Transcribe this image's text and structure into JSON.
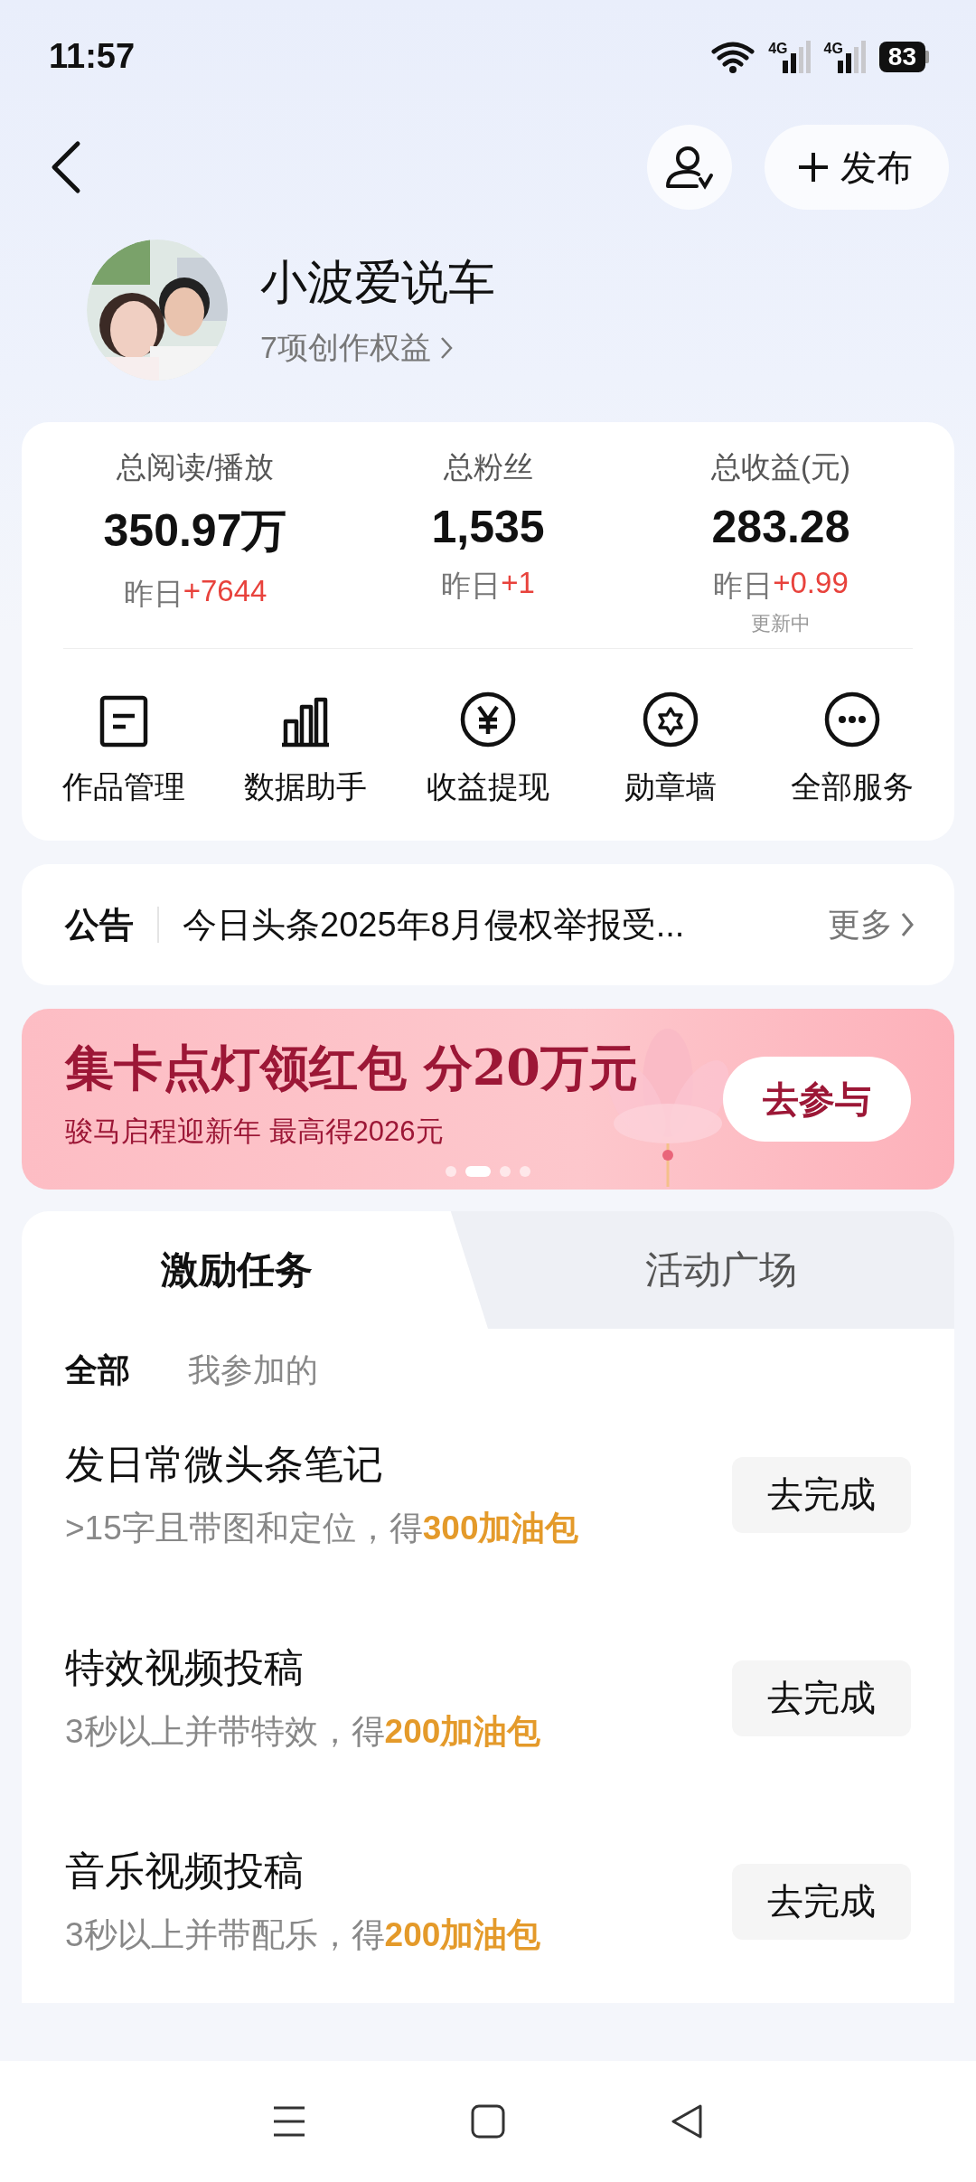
{
  "status_bar": {
    "time": "11:57",
    "networks": [
      "4G",
      "4G"
    ],
    "battery": "83"
  },
  "header": {
    "publish_label": "发布"
  },
  "profile": {
    "name": "小波爱说车",
    "benefits": "7项创作权益"
  },
  "stats": [
    {
      "label": "总阅读/播放",
      "value": "350.97万",
      "yesterday_label": "昨日",
      "change": "+7644"
    },
    {
      "label": "总粉丝",
      "value": "1,535",
      "yesterday_label": "昨日",
      "change": "+1"
    },
    {
      "label": "总收益(元)",
      "value": "283.28",
      "yesterday_label": "昨日",
      "change": "+0.99",
      "note": "更新中"
    }
  ],
  "services": [
    {
      "kind": "document",
      "label": "作品管理"
    },
    {
      "kind": "chart",
      "label": "数据助手"
    },
    {
      "kind": "yuan",
      "label": "收益提现"
    },
    {
      "kind": "badge",
      "label": "勋章墙"
    },
    {
      "kind": "more",
      "label": "全部服务"
    }
  ],
  "notice": {
    "label": "公告",
    "text": "今日头条2025年8月侵权举报受...",
    "more": "更多"
  },
  "banner": {
    "title": "集卡点灯领红包 分20万元",
    "subtitle": "骏马启程迎新年 最高得2026元",
    "button": "去参与",
    "pager": [
      {
        "selected": false
      },
      {
        "selected": true
      },
      {
        "selected": false
      },
      {
        "selected": false
      }
    ]
  },
  "tabs": [
    {
      "label": "激励任务",
      "selected": true
    },
    {
      "label": "活动广场",
      "selected": false
    }
  ],
  "filters": [
    {
      "label": "全部",
      "selected": true
    },
    {
      "label": "我参加的",
      "selected": false
    }
  ],
  "tasks": [
    {
      "title": "发日常微头条笔记",
      "description": ">15字且带图和定位，得",
      "reward": "300加油包",
      "button": "去完成"
    },
    {
      "title": "特效视频投稿",
      "description": "3秒以上并带特效，得",
      "reward": "200加油包",
      "button": "去完成"
    },
    {
      "title": "音乐视频投稿",
      "description": "3秒以上并带配乐，得",
      "reward": "200加油包",
      "button": "去完成"
    }
  ]
}
